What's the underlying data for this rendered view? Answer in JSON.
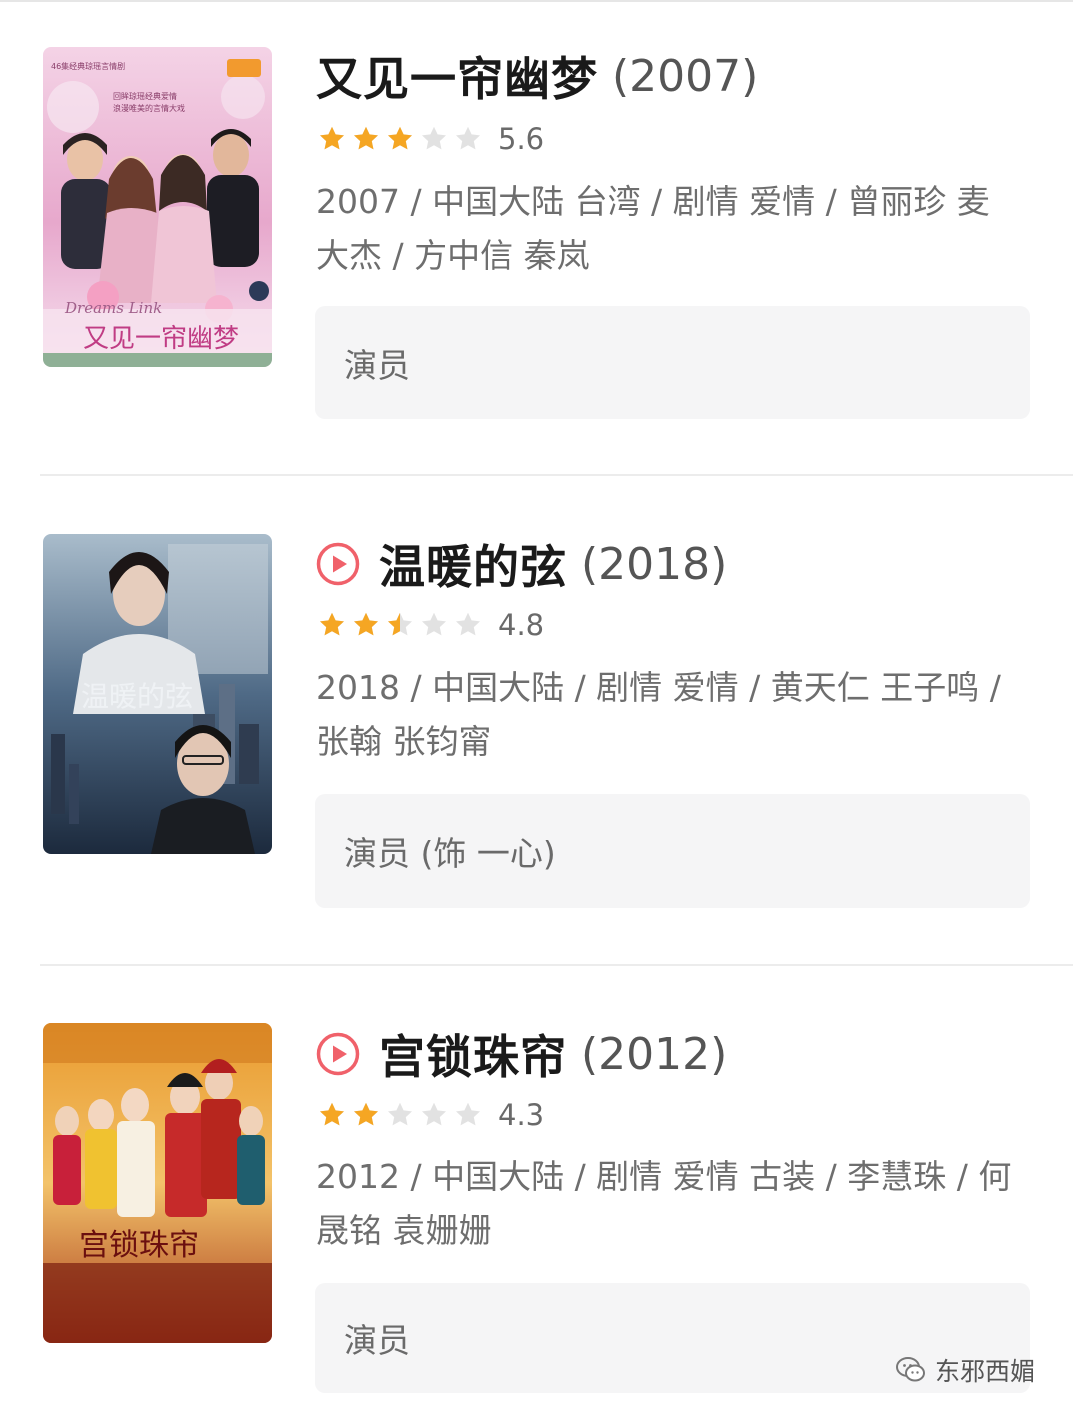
{
  "colors": {
    "star_on": "#f5a623",
    "star_off": "#e2e2e2",
    "play_accent": "#f0616a",
    "role_bg": "#f5f5f6"
  },
  "items": [
    {
      "title": "又见一帘幽梦",
      "year": "(2007)",
      "playable": false,
      "stars": 3,
      "score": "5.6",
      "meta": "2007 / 中国大陆 台湾 / 剧情 爱情 / 曾丽珍 麦大杰 / 方中信 秦岚",
      "role": "演员",
      "poster": {
        "top_text": "46集经典琼瑶言情剧",
        "tagline": "回眸琼瑶经典爱情 浪漫唯美的言情大戏",
        "english": "Dreams Link",
        "title": "又见一帘幽梦"
      }
    },
    {
      "title": "温暖的弦",
      "year": "(2018)",
      "playable": true,
      "stars": 2.5,
      "score": "4.8",
      "meta": "2018 / 中国大陆 / 剧情 爱情 / 黄天仁 王子鸣 / 张翰 张钧甯",
      "role": "演员 (饰 一心)",
      "poster": {
        "title": "温暖的弦"
      }
    },
    {
      "title": "宫锁珠帘",
      "year": "(2012)",
      "playable": true,
      "stars": 2,
      "score": "4.3",
      "meta": "2012 / 中国大陆 / 剧情 爱情 古装 / 李慧珠 / 何晟铭 袁姗姗",
      "role": "演员",
      "poster": {
        "title": "宫锁珠帘"
      }
    }
  ],
  "watermark": {
    "icon": "wechat-icon",
    "text": "东邪西媚"
  }
}
